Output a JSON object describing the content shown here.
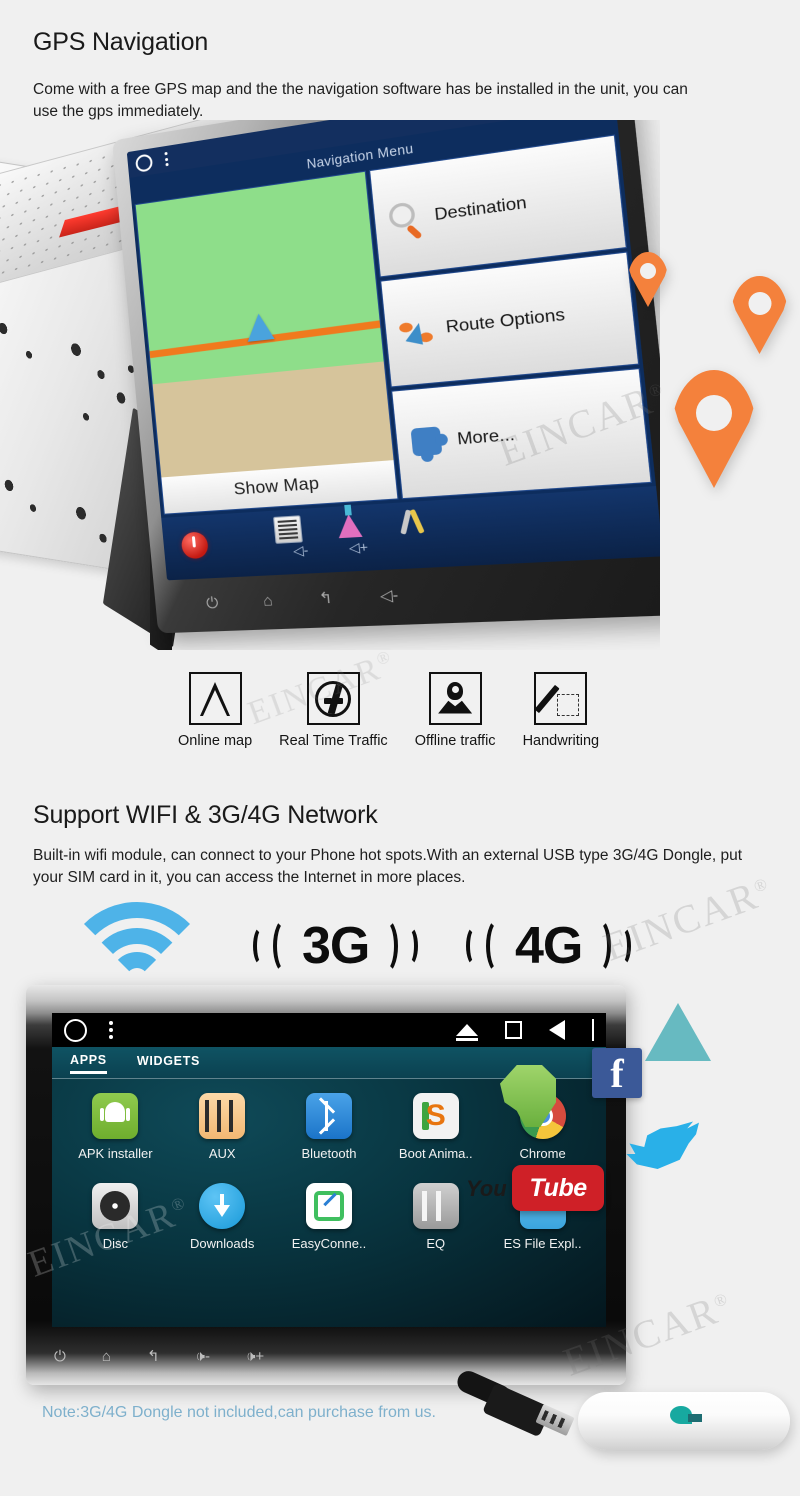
{
  "brand": {
    "watermark": "EINCAR",
    "watermark_mark": "®"
  },
  "sections": [
    {
      "id": "gps",
      "title": "GPS Navigation",
      "description": "Come with a free GPS map and the the navigation software has be installed in the unit, you can use the gps immediately."
    },
    {
      "id": "wifi",
      "title": "Support WIFI & 3G/4G Network",
      "description": "Built-in wifi module, can connect to your Phone hot spots.With an external USB type 3G/4G Dongle, put your SIM card in it, you can access the Internet in more places."
    }
  ],
  "nav_screen": {
    "menu_title": "Navigation Menu",
    "map_button": "Show Map",
    "menu_items": [
      {
        "label": "Destination",
        "icon": "magnifier-icon"
      },
      {
        "label": "Route Options",
        "icon": "route-arrow-icon"
      },
      {
        "label": "More...",
        "icon": "puzzle-icon"
      }
    ],
    "tray_icons": [
      "calculator-icon",
      "flask-icon",
      "tools-icon"
    ],
    "status_icons": [
      "home-circle-icon",
      "menu-kebab-icon",
      "eject-triangle-icon",
      "recents-square-icon",
      "back-triangle-icon"
    ],
    "hardware_keys": [
      "power-icon",
      "home-icon",
      "back-icon",
      "volume-down-icon",
      "volume-up-icon"
    ],
    "volume_labels": [
      "vol-down",
      "vol-up"
    ]
  },
  "features": [
    {
      "label": "Online map",
      "icon": "compass-arrow-icon"
    },
    {
      "label": "Real Time Traffic",
      "icon": "traffic-cars-icon"
    },
    {
      "label": "Offline traffic",
      "icon": "map-pin-icon"
    },
    {
      "label": "Handwriting",
      "icon": "pen-pad-icon"
    }
  ],
  "network_badges": [
    {
      "label": "3G",
      "icon": "signal-waves-icon"
    },
    {
      "label": "4G",
      "icon": "signal-waves-icon"
    }
  ],
  "wifi_icon": "wifi-waves-icon",
  "android_screen": {
    "tabs": [
      {
        "label": "APPS",
        "active": true
      },
      {
        "label": "WIDGETS",
        "active": false
      }
    ],
    "status_icons": [
      "home-circle-icon",
      "menu-kebab-icon",
      "eject-triangle-icon",
      "recents-square-icon",
      "back-triangle-icon",
      "divider-bar-icon"
    ],
    "apps_row1": [
      {
        "label": "APK installer",
        "icon": "android-robot-icon"
      },
      {
        "label": "AUX",
        "icon": "aux-jack-icon"
      },
      {
        "label": "Bluetooth",
        "icon": "bluetooth-icon"
      },
      {
        "label": "Boot Anima..",
        "icon": "sogou-s-icon"
      },
      {
        "label": "Chrome",
        "icon": "chrome-icon"
      }
    ],
    "apps_row2": [
      {
        "label": "Disc",
        "icon": "disc-icon"
      },
      {
        "label": "Downloads",
        "icon": "download-arrow-icon"
      },
      {
        "label": "EasyConne..",
        "icon": "easyconnect-icon"
      },
      {
        "label": "EQ",
        "icon": "equalizer-sliders-icon"
      },
      {
        "label": "ES File Expl..",
        "icon": "es-file-explorer-icon"
      }
    ],
    "hardware_keys": [
      "⏻",
      "⌂",
      "↰",
      "🕩-",
      "🕩+"
    ]
  },
  "floating_logos": [
    {
      "name": "evernote-logo",
      "label": ""
    },
    {
      "name": "facebook-logo",
      "label": "f"
    },
    {
      "name": "google-plus-logo",
      "label": ""
    },
    {
      "name": "twitter-logo",
      "label": ""
    },
    {
      "name": "youtube-logo",
      "label": "Tube",
      "prefix": "You"
    }
  ],
  "note": "Note:3G/4G Dongle not included,can purchase from us.",
  "colors": {
    "page_bg": "#f0f0f0",
    "pin_orange": "#f4813c",
    "wifi_blue": "#4eb3e8",
    "note_blue": "#7eb0cc",
    "nav_blue": "#0d2d5e",
    "android_teal": "#0f5363",
    "facebook_blue": "#3b5998",
    "twitter_blue": "#29b0e8",
    "youtube_red": "#cf2027"
  }
}
